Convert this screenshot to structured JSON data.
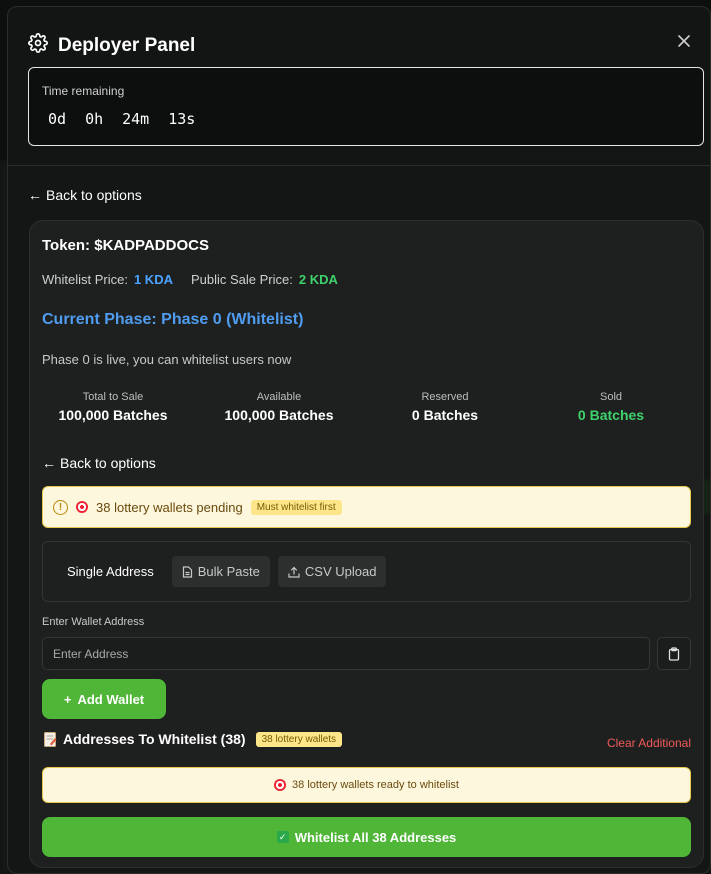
{
  "modal": {
    "title": "Deployer Panel",
    "title_icon": "gear-icon",
    "close_icon": "close-icon"
  },
  "timer": {
    "label": "Time remaining",
    "days": "0d",
    "hours": "0h",
    "minutes": "24m",
    "seconds": "13s"
  },
  "back_link": {
    "arrow": "←",
    "label": "Back to options"
  },
  "token": {
    "title": "Token: $KADPADDOCS",
    "whitelist_price_label": "Whitelist Price:",
    "whitelist_price": "1 KDA",
    "public_price_label": "Public Sale Price:",
    "public_price": "2 KDA",
    "accent_blue": "#4aa3ff",
    "accent_green": "#3fd16b"
  },
  "phase": {
    "title": "Current Phase: Phase 0 (Whitelist)",
    "description": "Phase 0 is live, you can whitelist users now"
  },
  "stats": [
    {
      "label": "Total to Sale",
      "value": "100,000 Batches"
    },
    {
      "label": "Available",
      "value": "100,000 Batches"
    },
    {
      "label": "Reserved",
      "value": "0 Batches"
    },
    {
      "label": "Sold",
      "value": "0 Batches"
    }
  ],
  "lottery_banner": {
    "text": "38 lottery wallets pending",
    "badge": "Must whitelist first"
  },
  "tabs": [
    {
      "label": "Single Address",
      "icon": ""
    },
    {
      "label": "Bulk Paste",
      "icon": "document-icon"
    },
    {
      "label": "CSV Upload",
      "icon": "upload-icon"
    }
  ],
  "wallet_input": {
    "label": "Enter Wallet Address",
    "placeholder": "Enter Address",
    "paste_icon": "clipboard-icon"
  },
  "add_wallet": {
    "icon": "+",
    "label": "Add Wallet"
  },
  "addresses": {
    "title": "Addresses To Whitelist (38)",
    "badge": "38 lottery wallets",
    "clear_label": "Clear Additional",
    "ready_text": "38 lottery wallets ready to whitelist"
  },
  "whitelist_button": {
    "label": "Whitelist All 38 Addresses"
  },
  "colors": {
    "primary_green": "#4fb638",
    "danger": "#ef5a5a",
    "banner_bg": "#fdf8dd"
  }
}
